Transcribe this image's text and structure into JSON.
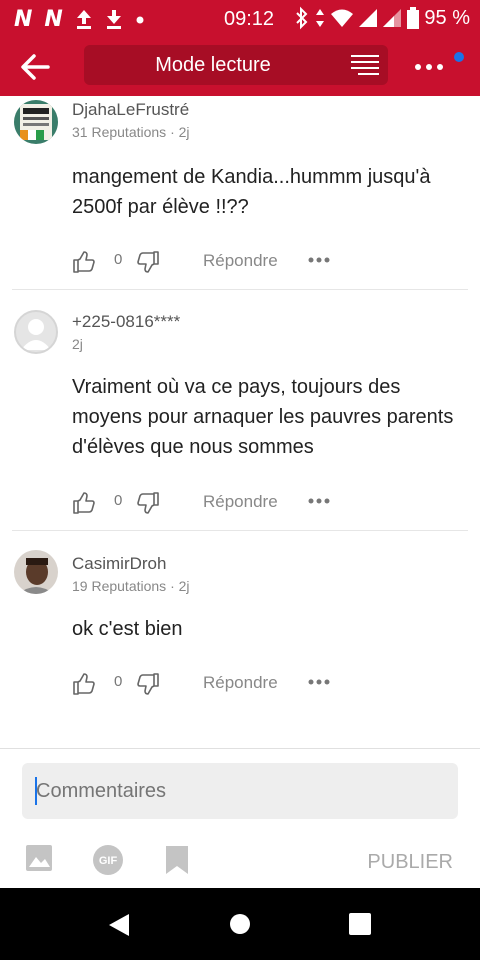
{
  "status": {
    "time": "09:12",
    "battery": "95 %"
  },
  "toolbar": {
    "title": "Mode lecture"
  },
  "comments": [
    {
      "author": "DjahaLeFrustré",
      "meta": "31 Reputations · 2j",
      "text": "mangement de Kandia...hummm jusqu'à 2500f par élève !!??",
      "likes": "0",
      "reply": "Répondre"
    },
    {
      "author": "+225-0816****",
      "meta": "2j",
      "text": "Vraiment où va ce pays, toujours des moyens pour arnaquer les pauvres parents d'élèves que nous sommes",
      "likes": "0",
      "reply": "Répondre"
    },
    {
      "author": "CasimirDroh",
      "meta": "19 Reputations · 2j",
      "text": "ok c'est bien",
      "likes": "0",
      "reply": "Répondre"
    }
  ],
  "composer": {
    "placeholder": "Commentaires",
    "gif_label": "GIF",
    "publish_label": "PUBLIER"
  },
  "colors": {
    "brand": "#c8102e",
    "accent": "#1a73e8"
  }
}
